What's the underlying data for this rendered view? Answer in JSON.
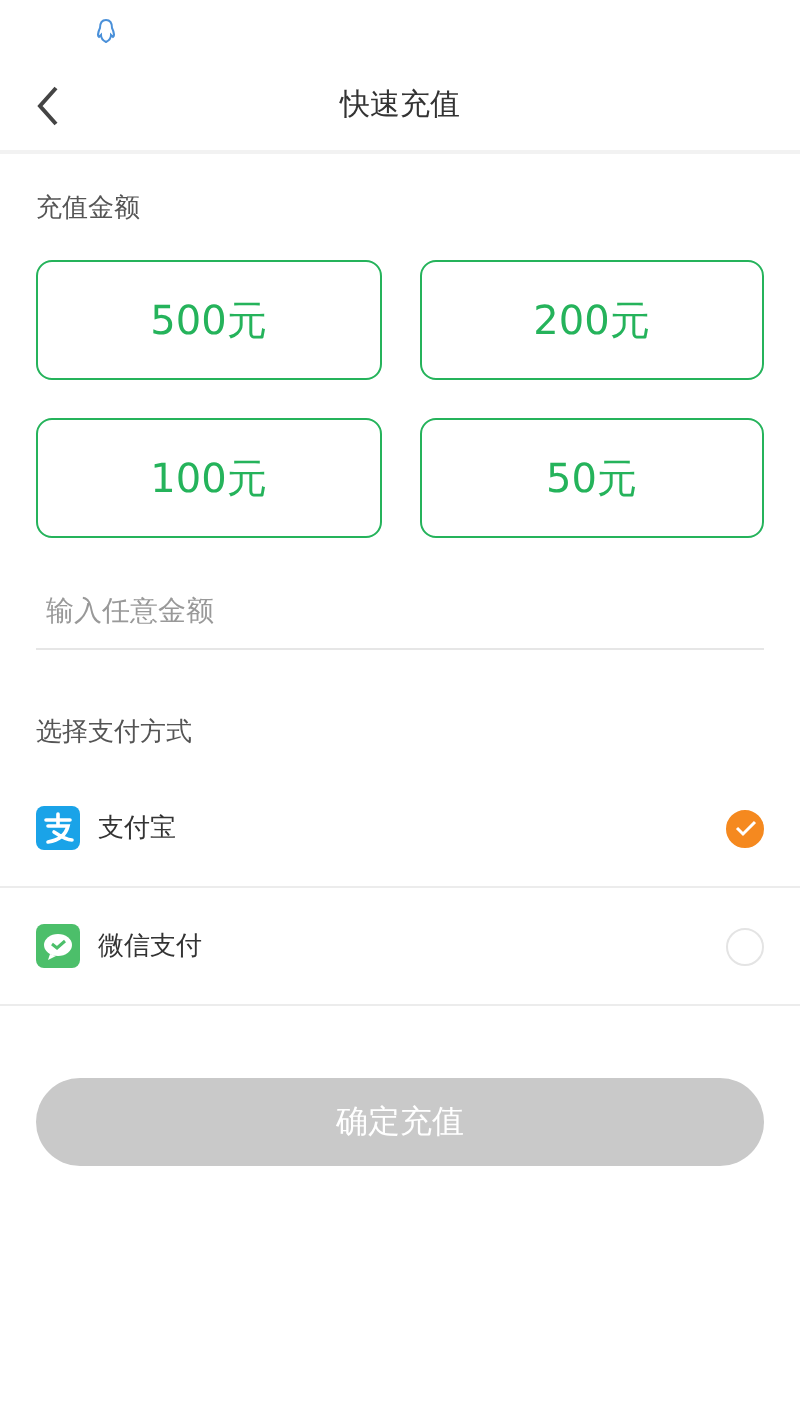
{
  "header": {
    "title": "快速充值"
  },
  "amount_section": {
    "label": "充值金额",
    "options": [
      {
        "label": "500元",
        "selected": false
      },
      {
        "label": "200元",
        "selected": false
      },
      {
        "label": "100元",
        "selected": false
      },
      {
        "label": "50元",
        "selected": false
      }
    ],
    "custom_amount": {
      "placeholder": "输入任意金额"
    }
  },
  "payment_section": {
    "label": "选择支付方式",
    "methods": [
      {
        "kind": "alipay",
        "label": "支付宝",
        "selected": true
      },
      {
        "kind": "wechat",
        "label": "微信支付",
        "selected": false
      }
    ]
  },
  "confirm_button": {
    "label": "确定充值",
    "disabled": true
  }
}
